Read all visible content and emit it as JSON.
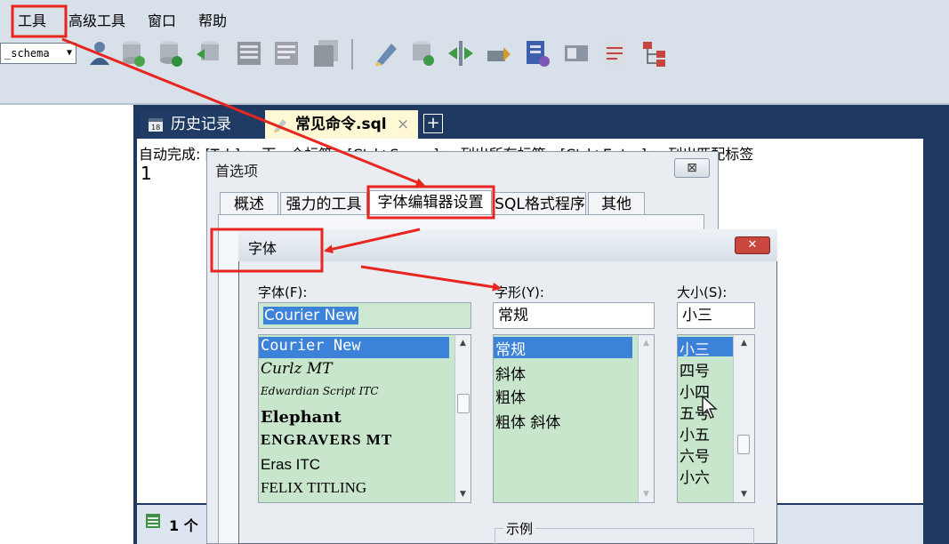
{
  "menu": {
    "items": [
      "工具",
      "高级工具",
      "窗口",
      "帮助"
    ]
  },
  "toolbar": {
    "schema_value": "_schema"
  },
  "editor": {
    "tabs": [
      {
        "label": "历史记录"
      },
      {
        "label": "常见命令.sql",
        "close": "×"
      }
    ],
    "add_tab": "+",
    "autocomplete_hint": "自动完成: [Tab]-> 下一个标签，[Ctrl+Space]-> 列出所有标签，[Ctrl+Enter]-> 列出匹配标签",
    "line_number": "1",
    "result_label": "1 个"
  },
  "preferences": {
    "title": "首选项",
    "close": "⊠",
    "tabs": [
      "概述",
      "强力的工具",
      "字体编辑器设置",
      "SQL格式程序",
      "其他"
    ]
  },
  "font_dialog": {
    "title": "字体",
    "close": "✕",
    "font_label": "字体(F):",
    "style_label": "字形(Y):",
    "size_label": "大小(S):",
    "font_value": "Courier New",
    "style_value": "常规",
    "size_value": "小三",
    "fonts": [
      "Courier New",
      "Curlz MT",
      "Edwardian Script ITC",
      "Elephant",
      "ENGRAVERS MT",
      "Eras ITC",
      "FELIX TITLING"
    ],
    "styles": [
      "常规",
      "斜体",
      "粗体",
      "粗体 斜体"
    ],
    "sizes": [
      "小三",
      "四号",
      "小四",
      "五号",
      "小五",
      "六号",
      "小六"
    ],
    "sample_label": "示例"
  },
  "colors": {
    "annotation": "#e8251f",
    "selection": "#3b82d8",
    "list_bg": "#c8e6cc",
    "frame": "#1f3860"
  }
}
